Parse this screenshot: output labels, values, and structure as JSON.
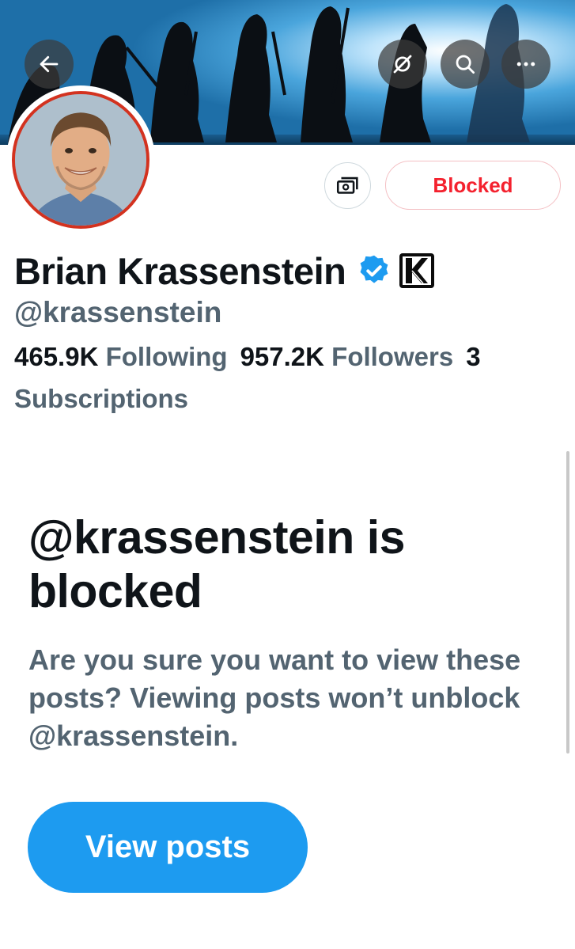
{
  "header": {
    "back_icon": "arrow-left-icon",
    "grok_icon": "grok-icon",
    "search_icon": "search-icon",
    "more_icon": "more-horizontal-icon"
  },
  "profile": {
    "display_name": "Brian Krassenstein",
    "handle": "@krassenstein",
    "verified": true,
    "affiliate_badge_letter": "K",
    "following_count": "465.9K",
    "following_label": "Following",
    "followers_count": "957.2K",
    "followers_label": "Followers",
    "subscriptions_count": "3",
    "subscriptions_label": "Subscriptions"
  },
  "actions": {
    "subscribe_icon": "money-icon",
    "blocked_label": "Blocked"
  },
  "blocked_notice": {
    "title": "@krassenstein is blocked",
    "message": "Are you sure you want to view these posts? Viewing posts won’t unblock @krassenstein.",
    "view_posts_label": "View posts"
  },
  "colors": {
    "accent": "#1d9bf0",
    "blocked_red": "#f4212e",
    "secondary_text": "#536471",
    "primary_text": "#0f1419"
  }
}
